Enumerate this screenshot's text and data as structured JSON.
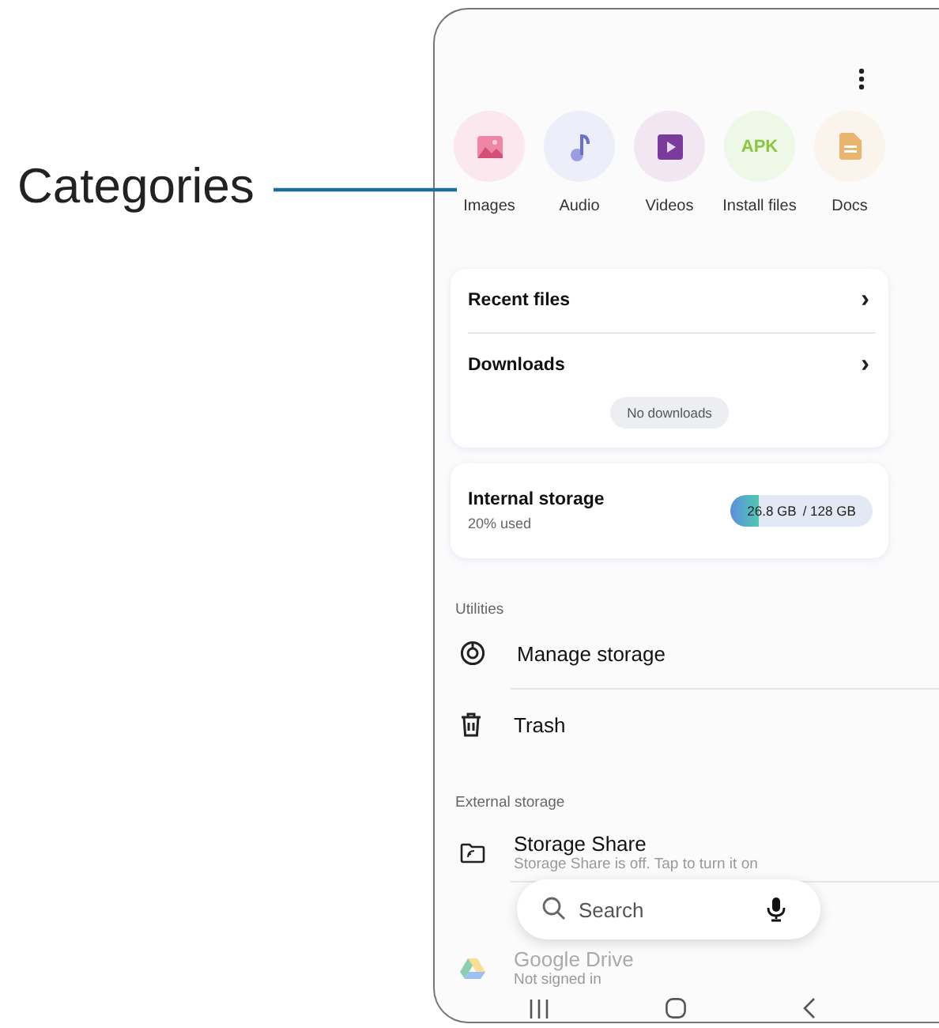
{
  "callout": {
    "label": "Categories"
  },
  "categories": [
    {
      "kind": "image",
      "label": "Images"
    },
    {
      "kind": "audio",
      "label": "Audio"
    },
    {
      "kind": "video",
      "label": "Videos"
    },
    {
      "kind": "apk",
      "icon_text": "APK",
      "label": "Install files"
    },
    {
      "kind": "doc",
      "label": "Docs"
    }
  ],
  "quick_card": {
    "items": [
      {
        "label": "Recent files",
        "chevron": "›"
      },
      {
        "label": "Downloads",
        "chevron": "›"
      }
    ],
    "empty_note": "No downloads"
  },
  "storage_card": {
    "title": "Internal storage",
    "subtitle": "20% used",
    "used": "26.8 GB",
    "total": "/ 128 GB",
    "level": 0.2
  },
  "utilities": {
    "heading": "Utilities",
    "items": [
      {
        "kind": "manage",
        "label": "Manage storage"
      },
      {
        "kind": "trash",
        "label": "Trash"
      }
    ]
  },
  "external_storage": {
    "heading": "External storage",
    "items": [
      {
        "kind": "folder",
        "label": "Storage Share",
        "subtitle": "Storage Share is off. Tap to turn it on"
      },
      {
        "kind": "drive",
        "label": "Google Drive",
        "subtitle": "Not signed in"
      }
    ]
  },
  "search": {
    "placeholder": "Search"
  }
}
